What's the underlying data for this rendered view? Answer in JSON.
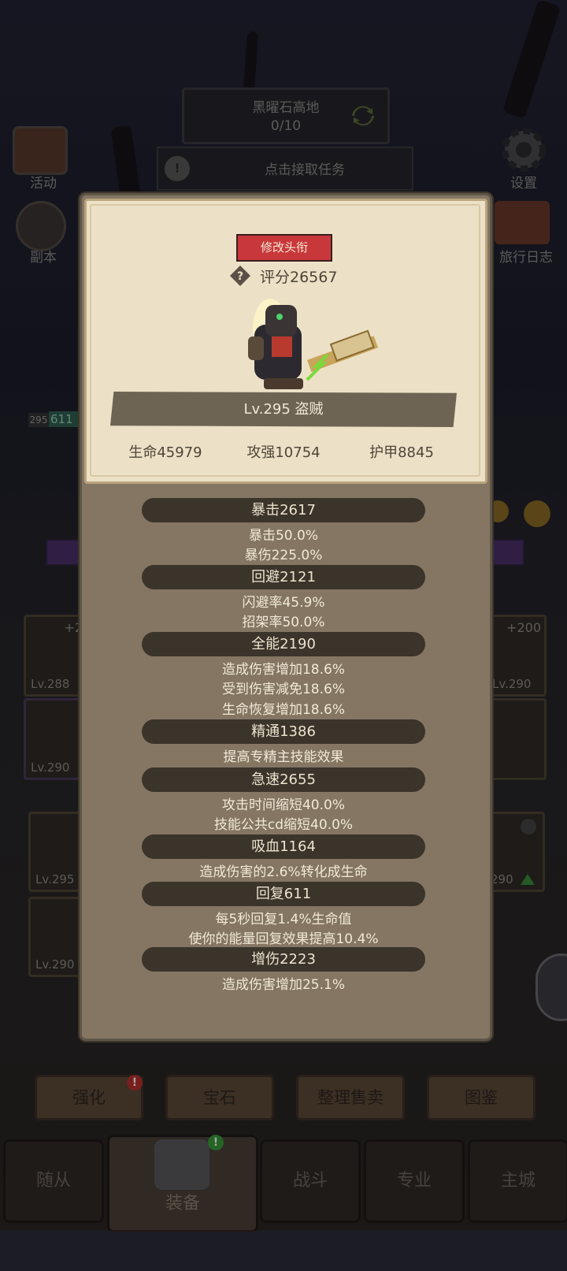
{
  "background": {
    "zone": {
      "title": "黑曜石高地",
      "progress": "0/10"
    },
    "quest_button": "点击接取任务",
    "left_icons": [
      {
        "label": "活动"
      },
      {
        "label": "副本"
      }
    ],
    "right_icons": [
      {
        "label": "设置"
      },
      {
        "label": "旅行日志"
      }
    ],
    "bottom_buttons": [
      "强化",
      "宝石",
      "整理售卖",
      "图鉴"
    ],
    "tabs": [
      "随从",
      "装备",
      "战斗",
      "专业",
      "主城"
    ],
    "slot_labels": {
      "left_top": "Lv.288",
      "left_mid": "Lv.290",
      "left_bag1": "Lv.295",
      "left_bag2": "Lv.290",
      "right_top": "Lv.290",
      "right_bag1": "290",
      "left_plus": "+2",
      "right_plus": "+200",
      "side_level": "295",
      "side_value": "611"
    }
  },
  "modal": {
    "edit_title_button": "修改头衔",
    "score": "评分26567",
    "level_class": "Lv.295 盗贼",
    "base_stats": [
      "生命45979",
      "攻强10754",
      "护甲8845"
    ],
    "sections": [
      {
        "title": "暴击2617",
        "details": [
          "暴击50.0%",
          "暴伤225.0%"
        ]
      },
      {
        "title": "回避2121",
        "details": [
          "闪避率45.9%",
          "招架率50.0%"
        ]
      },
      {
        "title": "全能2190",
        "details": [
          "造成伤害增加18.6%",
          "受到伤害减免18.6%",
          "生命恢复增加18.6%"
        ]
      },
      {
        "title": "精通1386",
        "details": [
          "提高专精主技能效果"
        ]
      },
      {
        "title": "急速2655",
        "details": [
          "攻击时间缩短40.0%",
          "技能公共cd缩短40.0%"
        ]
      },
      {
        "title": "吸血1164",
        "details": [
          "造成伤害的2.6%转化成生命"
        ]
      },
      {
        "title": "回复611",
        "details": [
          "每5秒回复1.4%生命值",
          "使你的能量回复效果提高10.4%"
        ]
      },
      {
        "title": "增伤2223",
        "details": [
          "造成伤害增加25.1%"
        ]
      }
    ]
  },
  "colors": {
    "accent_red": "#c8383b",
    "panel_parchment": "#ece1c6",
    "modal_body": "#847663"
  }
}
